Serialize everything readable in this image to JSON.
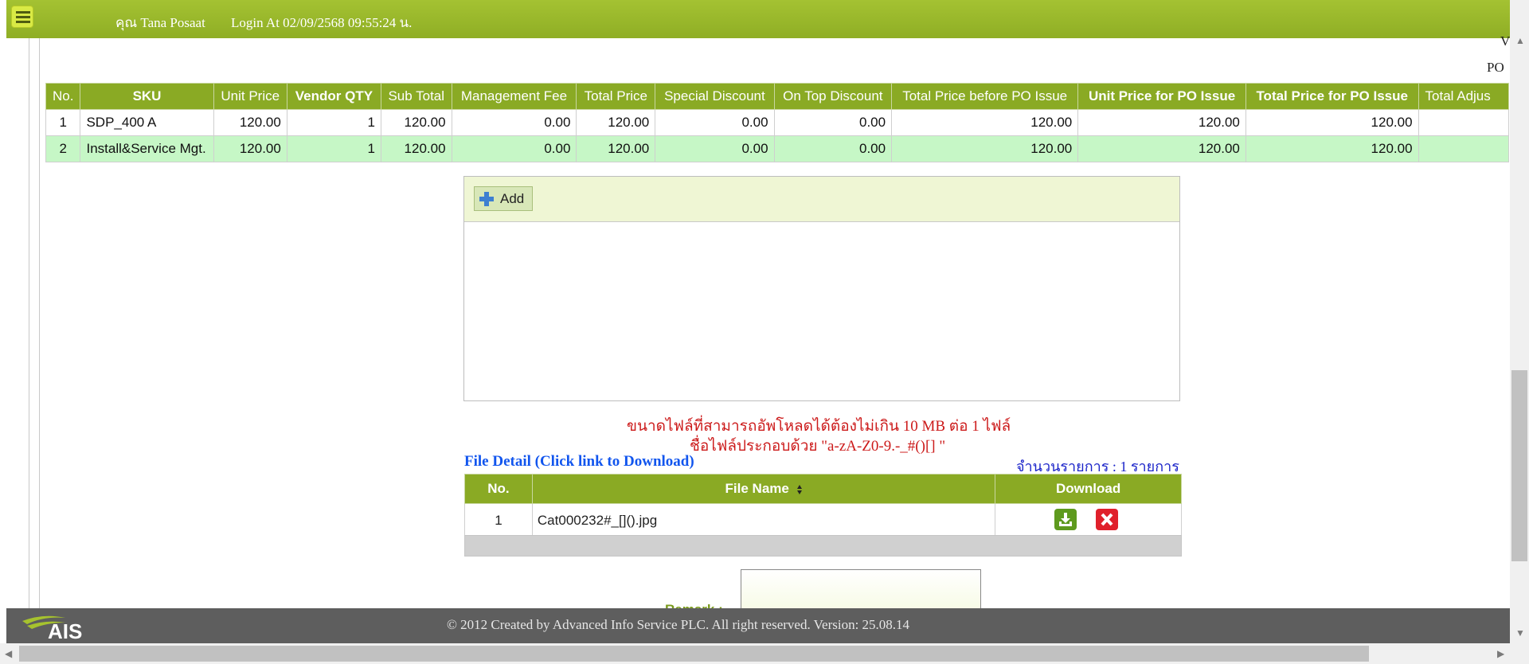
{
  "header": {
    "user_name": "คุณ Tana Posaat",
    "login_at": "Login At 02/09/2568 09:55:24 น."
  },
  "right_fragments": {
    "top": "V",
    "po": "PO"
  },
  "sku_table": {
    "columns": [
      "No.",
      "SKU",
      "Unit Price",
      "Vendor QTY",
      "Sub Total",
      "Management Fee",
      "Total Price",
      "Special Discount",
      "On Top Discount",
      "Total Price before PO Issue",
      "Unit Price for PO Issue",
      "Total Price for PO Issue",
      "Total Adjus"
    ],
    "rows": [
      [
        "1",
        "SDP_400 A",
        "120.00",
        "1",
        "120.00",
        "0.00",
        "120.00",
        "0.00",
        "0.00",
        "120.00",
        "120.00",
        "120.00",
        ""
      ],
      [
        "2",
        "Install&Service Mgt.",
        "120.00",
        "1",
        "120.00",
        "0.00",
        "120.00",
        "0.00",
        "0.00",
        "120.00",
        "120.00",
        "120.00",
        ""
      ]
    ]
  },
  "upload": {
    "add_label": "Add"
  },
  "messages": {
    "size_limit": "ขนาดไฟล์ที่สามารถอัพโหลดได้ต้องไม่เกิน 10 MB ต่อ 1 ไฟล์",
    "name_rule": "ชื่อไฟล์ประกอบด้วย \"a-zA-Z0-9.-_#()[] \""
  },
  "file_detail": {
    "title": "File Detail (Click link to Download)",
    "count_text": "จำนวนรายการ : 1 รายการ",
    "columns": [
      "No.",
      "File Name",
      "Download"
    ],
    "rows": [
      {
        "no": "1",
        "file_name": "Cat000232#_[]().jpg"
      }
    ]
  },
  "remark": {
    "label": "Remark :"
  },
  "footer": {
    "copyright": "© 2012 Created by Advanced Info Service PLC.  All right reserved.   Version: 25.08.14",
    "logo_text": "AIS"
  },
  "colors": {
    "header_green": "#95b42a",
    "table_header": "#8aaa24",
    "row_alt": "#c6f7c6",
    "warning_red": "#cc1a1a",
    "link_blue": "#1155ee"
  }
}
